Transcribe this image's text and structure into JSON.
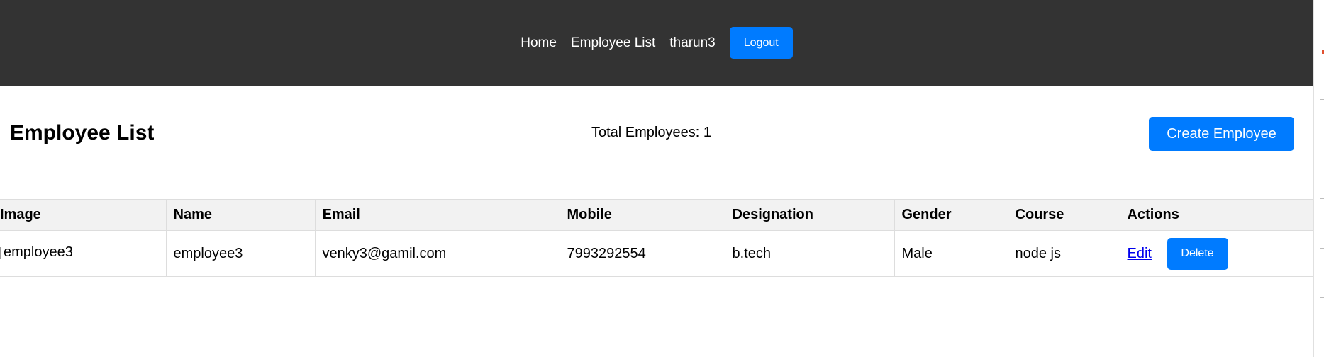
{
  "nav": {
    "home_label": "Home",
    "employee_list_label": "Employee List",
    "username": "tharun3",
    "logout_label": "Logout"
  },
  "header": {
    "title": "Employee List",
    "total_employees": "Total Employees: 1",
    "create_label": "Create Employee"
  },
  "table": {
    "columns": [
      "Image",
      "Name",
      "Email",
      "Mobile",
      "Designation",
      "Gender",
      "Course",
      "Actions"
    ],
    "rows": [
      {
        "image_alt": "employee3",
        "name": "employee3",
        "email": "venky3@gamil.com",
        "mobile": "7993292554",
        "designation": "b.tech",
        "gender": "Male",
        "course": "node js",
        "edit_label": "Edit",
        "delete_label": "Delete"
      }
    ]
  },
  "colors": {
    "navbar_bg": "#333333",
    "button_blue": "#007bff",
    "table_header_bg": "#f2f2f2",
    "link_color": "#0000ee"
  }
}
